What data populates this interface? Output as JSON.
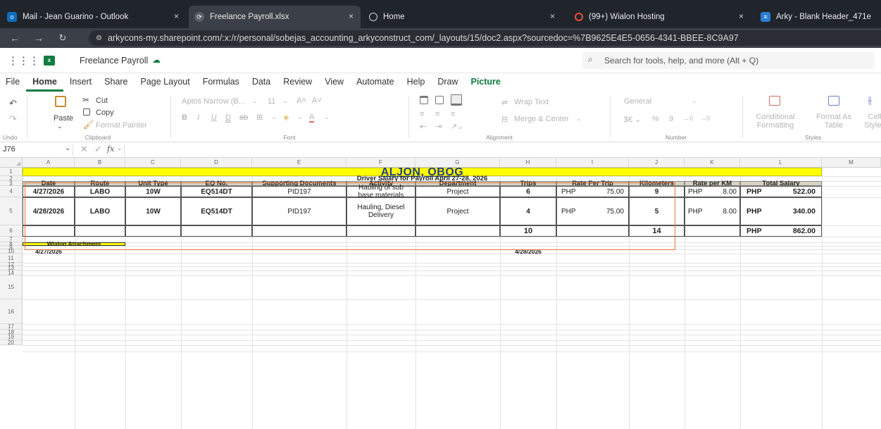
{
  "browser": {
    "tabs": [
      {
        "title": "Mail - Jean Guarino - Outlook",
        "close": "×"
      },
      {
        "title": "Freelance Payroll.xlsx",
        "close": "×"
      },
      {
        "title": "Home",
        "close": "×"
      },
      {
        "title": "(99+) Wialon Hosting",
        "close": "×"
      },
      {
        "title": "Arky - Blank Header_471e",
        "close": ""
      }
    ],
    "url": "arkycons-my.sharepoint.com/:x:/r/personal/sobejas_accounting_arkyconstruct_com/_layouts/15/doc2.aspx?sourcedoc=%7B9625E4E5-0656-4341-BBEE-8C9A97"
  },
  "app": {
    "filename": "Freelance Payroll",
    "search_placeholder": "Search for tools, help, and more (Alt + Q)"
  },
  "menu": [
    "File",
    "Home",
    "Insert",
    "Share",
    "Page Layout",
    "Formulas",
    "Data",
    "Review",
    "View",
    "Automate",
    "Help",
    "Draw",
    "Picture"
  ],
  "ribbon": {
    "undo_label": "Undo",
    "paste_label": "Paste",
    "cut_label": "Cut",
    "copy_label": "Copy",
    "format_painter_label": "Format Painter",
    "clipboard_label": "Clipboard",
    "font_name": "Aptos Narrow (B...",
    "font_size": "11",
    "font_label": "Font",
    "wrap_text_label": "Wrap Text",
    "merge_center_label": "Merge & Center",
    "alignment_label": "Alignment",
    "number_format": "General",
    "number_label": "Number",
    "conditional_formatting_label": "Conditional Formatting",
    "format_as_table_label": "Format As Table",
    "cell_styles_label": "Cell Styles",
    "styles_label": "Styles"
  },
  "formula_bar": {
    "name_box": "J76",
    "fx": "fx",
    "value": ""
  },
  "sheet": {
    "columns": [
      "A",
      "B",
      "C",
      "D",
      "E",
      "F",
      "G",
      "H",
      "I",
      "J",
      "K",
      "L",
      "M"
    ],
    "rows": [
      "1",
      "2",
      "3",
      "4",
      "5",
      "6",
      "7",
      "8",
      "9",
      "10",
      "11",
      "12",
      "13",
      "14",
      "15",
      "16",
      "17",
      "18",
      "19",
      "20"
    ],
    "title": "ALJON, OBOG",
    "subtitle": "Driver Salary for Payroll April 27-28, 2026",
    "headers": [
      "Date",
      "Route",
      "Unit Type",
      "EQ No.",
      "Supporting Documents",
      "Activity",
      "Department",
      "Trips",
      "Rate Per Trip",
      "Kilometers",
      "Rate per KM",
      "Total Salary"
    ],
    "records": [
      {
        "date": "4/27/2026",
        "route": "LABO",
        "unit": "10W",
        "eq": "EQ514DT",
        "doc": "PID197",
        "activity": "Hauling of sub base materials",
        "dept": "Project",
        "trips": "6",
        "rate_cur": "PHP",
        "rate": "75.00",
        "km": "9",
        "rkm_cur": "PHP",
        "rkm": "8.00",
        "tot_cur": "PHP",
        "total": "522.00"
      },
      {
        "date": "4/28/2026",
        "route": "LABO",
        "unit": "10W",
        "eq": "EQ514DT",
        "doc": "PID197",
        "activity": "Hauling, Diesel Delivery",
        "dept": "Project",
        "trips": "4",
        "rate_cur": "PHP",
        "rate": "75.00",
        "km": "5",
        "rkm_cur": "PHP",
        "rkm": "8.00",
        "tot_cur": "PHP",
        "total": "340.00"
      }
    ],
    "totals": {
      "trips": "10",
      "km": "14",
      "cur": "PHP",
      "total": "862.00"
    },
    "wialon_label": "Wialon Attachment",
    "wialon_date_1": "4/27/2026",
    "wialon_date_2": "4/28/2026"
  },
  "colors": {
    "title_fill": "#ffff00",
    "header_fill": "#d9d3c3",
    "selection_outline": "#e8743b",
    "excel_green": "#107c41"
  }
}
